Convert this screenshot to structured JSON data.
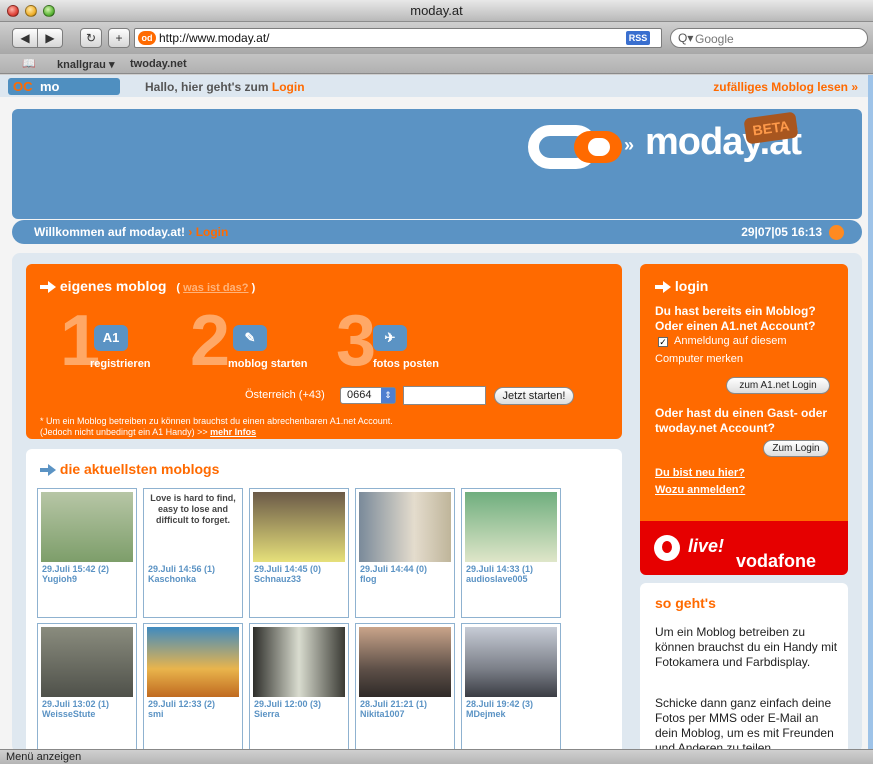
{
  "window": {
    "title": "moday.at"
  },
  "toolbar": {
    "back": "◀",
    "forward": "▶",
    "reload": "↻",
    "add": "+",
    "url": "http://www.moday.at/",
    "favicon": "od",
    "rss": "RSS",
    "search_placeholder": "Google"
  },
  "bookmarks": {
    "items": [
      "knallgrau ▾",
      "twoday.net"
    ]
  },
  "page": {
    "logo_small": "mo",
    "hallo": "Hallo, hier geht's zum ",
    "hallo_link": "Login",
    "random": "zufälliges Moblog lesen »",
    "banner_logo": "moday.at",
    "beta": "BETA",
    "welcome": "Willkommen auf moday.at! ",
    "welcome_link": "› Login",
    "datetime": "29|07|05 16:13"
  },
  "own_moblog": {
    "heading": "eigenes moblog",
    "what_is": "was ist das?",
    "steps": [
      {
        "num": "1",
        "icon": "A1",
        "label": "registrieren"
      },
      {
        "num": "2",
        "icon": "✎",
        "label": "moblog starten"
      },
      {
        "num": "3",
        "icon": "✈",
        "label": "fotos posten"
      }
    ],
    "country": "Österreich (+43)",
    "prefix": "0664",
    "start_button": "Jetzt starten!",
    "note1": "* Um ein Moblog betreiben zu können brauchst du einen abrechenbaren A1.net Account.",
    "note2": "(Jedoch nicht unbedingt ein A1 Handy) >> ",
    "note_link": "mehr Infos"
  },
  "latest": {
    "heading": "die aktuellsten moblogs",
    "items": [
      {
        "time": "29.Juli 15:42 (2)",
        "user": "Yugioh9",
        "bg": "#7d9e6a"
      },
      {
        "time": "29.Juli 14:56 (1)",
        "user": "Kaschonka",
        "quote": "Love is hard to find, easy to lose and difficult to forget."
      },
      {
        "time": "29.Juli 14:45 (0)",
        "user": "Schnauz33",
        "bg": "#b9c07a"
      },
      {
        "time": "29.Juli 14:44 (0)",
        "user": "flog",
        "bg": "#b9a891"
      },
      {
        "time": "29.Juli 14:33 (1)",
        "user": "audioslave005",
        "bg": "#8fba9c"
      },
      {
        "time": "29.Juli 13:02 (1)",
        "user": "WeisseStute",
        "bg": "#6b6d62"
      },
      {
        "time": "29.Juli 12:33 (2)",
        "user": "smi",
        "bg": "#d7a64a"
      },
      {
        "time": "29.Juli 12:00 (3)",
        "user": "Sierra",
        "bg": "#5a5a52"
      },
      {
        "time": "28.Juli 21:21 (1)",
        "user": "Nikita1007",
        "bg": "#8c7e78"
      },
      {
        "time": "28.Juli 19:42 (3)",
        "user": "MDejmek",
        "bg": "#9a9ca6"
      }
    ]
  },
  "login": {
    "heading": "login",
    "q1": "Du hast bereits ein Moblog? Oder einen A1.net Account?",
    "remember1": "Anmeldung auf diesem",
    "remember2": "Computer merken",
    "a1_button": "zum A1.net Login",
    "q2": "Oder hast du einen Gast- oder twoday.net Account?",
    "login_button": "Zum Login",
    "new_here": "Du bist neu hier?",
    "why_register": "Wozu anmelden?",
    "vodafone": "vodafone",
    "live": "live!"
  },
  "howto": {
    "heading": "so geht's",
    "p1": "Um ein Moblog betreiben zu können brauchst du ein Handy mit Fotokamera und Farbdisplay.",
    "p2": "Schicke dann ganz einfach deine Fotos per MMS oder E-Mail an dein Moblog, um es mit Freunden und Anderen zu teilen."
  },
  "status": "Menü anzeigen"
}
